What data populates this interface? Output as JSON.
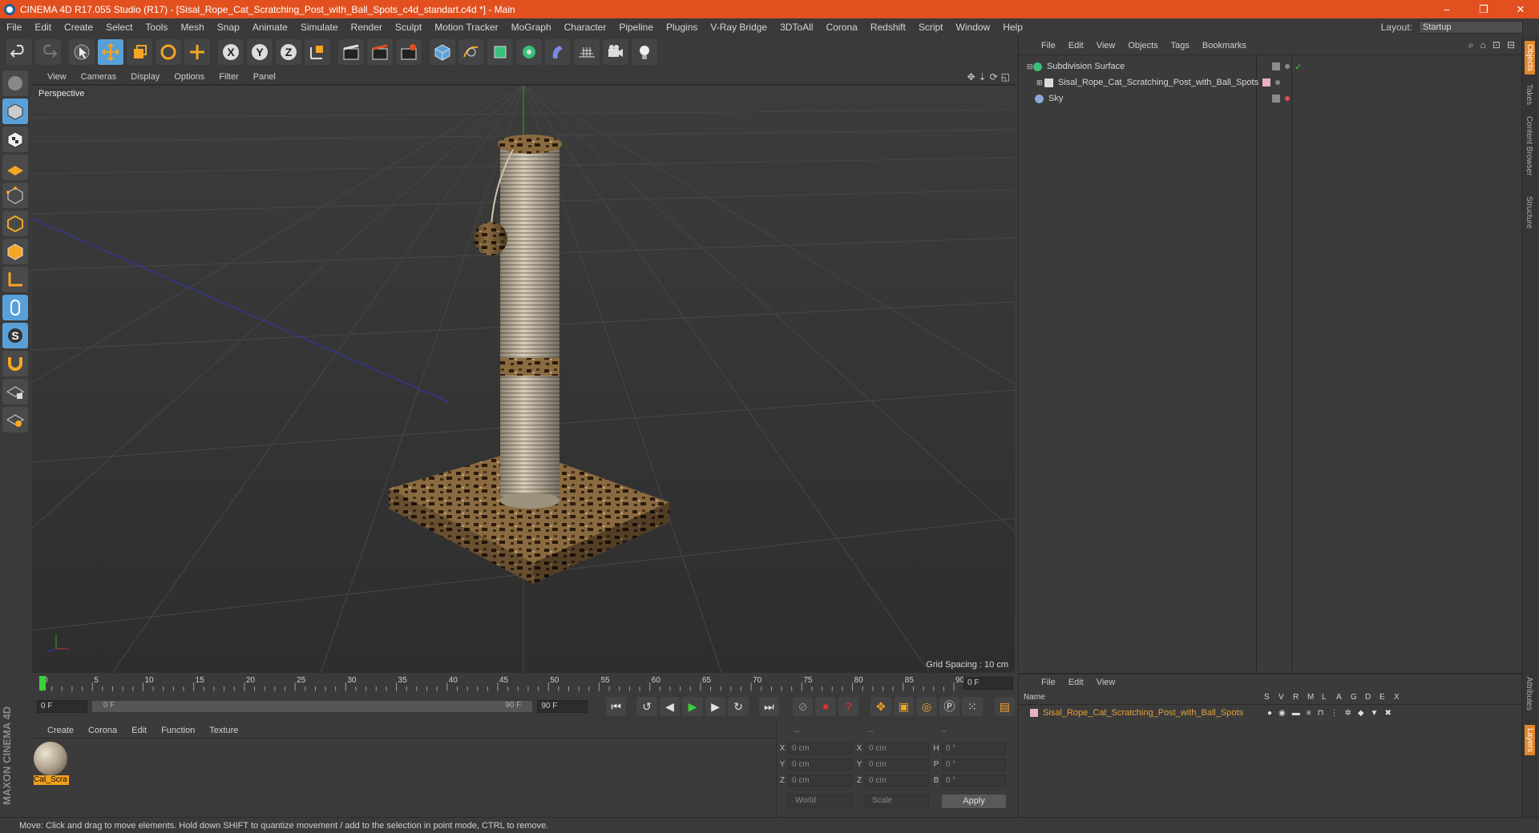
{
  "window": {
    "title": "CINEMA 4D R17.055 Studio (R17) - [Sisal_Rope_Cat_Scratching_Post_with_Ball_Spots_c4d_standart.c4d *] - Main",
    "controls": [
      "–",
      "❐",
      "✕"
    ]
  },
  "menu": {
    "items": [
      "File",
      "Edit",
      "Create",
      "Select",
      "Tools",
      "Mesh",
      "Snap",
      "Animate",
      "Simulate",
      "Render",
      "Sculpt",
      "Motion Tracker",
      "MoGraph",
      "Character",
      "Pipeline",
      "Plugins",
      "V-Ray Bridge",
      "3DToAll",
      "Corona",
      "Redshift",
      "Script",
      "Window",
      "Help"
    ],
    "layout_label": "Layout:",
    "layout_value": "Startup"
  },
  "viewport": {
    "menu": [
      "View",
      "Cameras",
      "Display",
      "Options",
      "Filter",
      "Panel"
    ],
    "camera": "Perspective",
    "grid_spacing": "Grid Spacing : 10 cm"
  },
  "timeline": {
    "ticks": [
      "0",
      "5",
      "10",
      "15",
      "20",
      "25",
      "30",
      "35",
      "40",
      "45",
      "50",
      "55",
      "60",
      "65",
      "70",
      "75",
      "80",
      "85",
      "90"
    ],
    "current_frame": "0 F",
    "start": "0 F",
    "range_start": "0 F",
    "range_end": "90 F",
    "end": "90 F"
  },
  "materials": {
    "menu": [
      "Create",
      "Corona",
      "Edit",
      "Function",
      "Texture"
    ],
    "items": [
      {
        "name": "Cat_Scra"
      }
    ]
  },
  "coordinates": {
    "headers": [
      "--",
      "--",
      "--"
    ],
    "rows": [
      {
        "a1": "X",
        "v1": "0 cm",
        "a2": "X",
        "v2": "0 cm",
        "a3": "H",
        "v3": "0 °"
      },
      {
        "a1": "Y",
        "v1": "0 cm",
        "a2": "Y",
        "v2": "0 cm",
        "a3": "P",
        "v3": "0 °"
      },
      {
        "a1": "Z",
        "v1": "0 cm",
        "a2": "Z",
        "v2": "0 cm",
        "a3": "B",
        "v3": "0 °"
      }
    ],
    "space": "World",
    "mode": "Scale",
    "apply": "Apply"
  },
  "objects": {
    "menu": [
      "File",
      "Edit",
      "View",
      "Objects",
      "Tags",
      "Bookmarks"
    ],
    "items": [
      {
        "name": "Subdivision Surface",
        "icon_color": "#38c07a"
      },
      {
        "name": "Sisal_Rope_Cat_Scratching_Post_with_Ball_Spots",
        "icon_color": "#dcdcdc"
      },
      {
        "name": "Sky",
        "icon_color": "#8aa8d8"
      }
    ]
  },
  "layers": {
    "menu": [
      "File",
      "Edit",
      "View"
    ],
    "header": [
      "Name",
      "S",
      "V",
      "R",
      "M",
      "L",
      "A",
      "G",
      "D",
      "E",
      "X"
    ],
    "row": "Sisal_Rope_Cat_Scratching_Post_with_Ball_Spots",
    "row_color": "#e2a23a"
  },
  "right_tabs": [
    "Objects",
    "Takes",
    "Content Browser",
    "Structure",
    "Attributes",
    "Layers"
  ],
  "brand": "MAXON CINEMA 4D",
  "status": "Move: Click and drag to move elements. Hold down SHIFT to quantize movement / add to the selection in point mode, CTRL to remove."
}
